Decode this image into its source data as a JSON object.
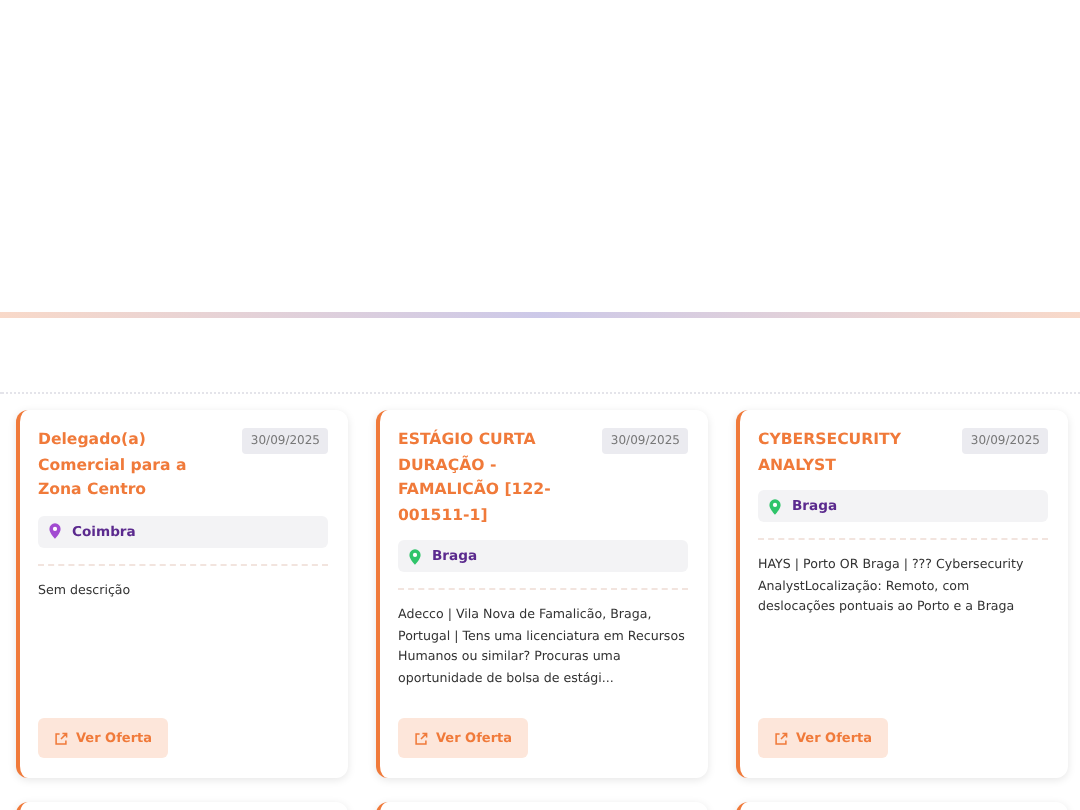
{
  "jobs": [
    {
      "title": "Delegado(a) Comercial para a Zona Centro",
      "date": "30/09/2025",
      "location": "Coimbra",
      "color": "#a24bd1",
      "description": "Sem descrição",
      "button": "Ver Oferta"
    },
    {
      "title": "ESTÁGIO CURTA DURAÇÃO - FAMALICÃO [122-001511-1]",
      "date": "30/09/2025",
      "location": "Braga",
      "color": "#2fc46a",
      "description": "Adecco | Vila Nova de Famalicão, Braga, Portugal | Tens uma licenciatura em Recursos Humanos ou similar? Procuras uma oportunidade de bolsa de estági...",
      "button": "Ver Oferta"
    },
    {
      "title": "CYBERSECURITY ANALYST",
      "date": "30/09/2025",
      "location": "Braga",
      "color": "#2fc46a",
      "description": "HAYS | Porto OR Braga | ??? Cybersecurity AnalystLocalização: Remoto, com deslocações pontuais ao Porto e a Braga",
      "button": "Ver Oferta"
    }
  ]
}
